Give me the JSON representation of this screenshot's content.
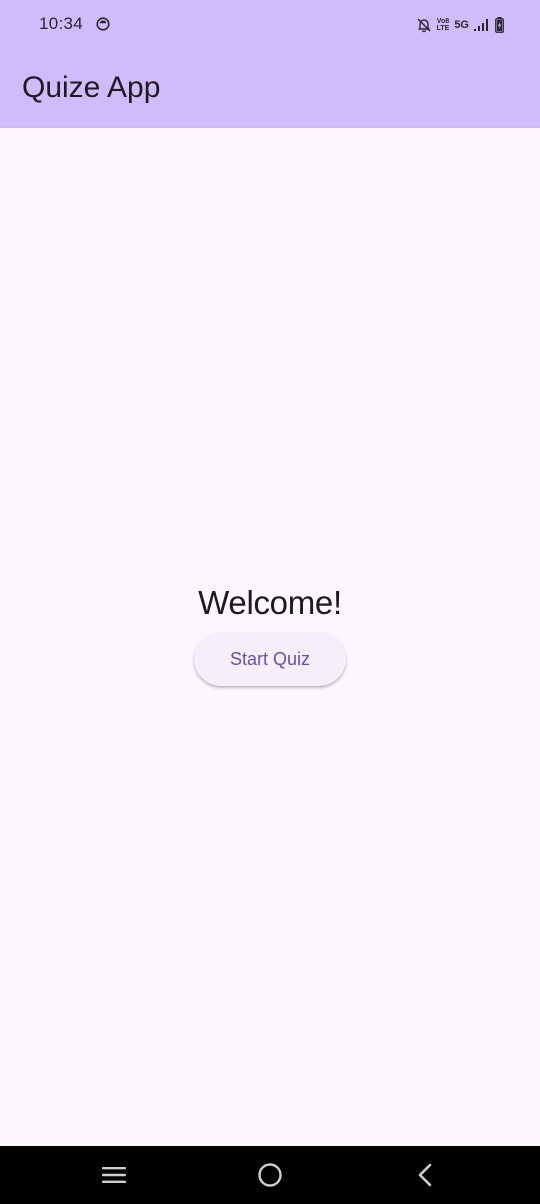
{
  "status_bar": {
    "time": "10:34",
    "app_icon": "notification-circle-icon",
    "muted_icon": "bell-off-icon",
    "volte_line1": "Vo8",
    "volte_line2": "LTE",
    "network": "5G",
    "signal_icon": "signal-icon",
    "battery_icon": "battery-charging-icon"
  },
  "app_bar": {
    "title": "Quize App",
    "background": "#d0bcfb"
  },
  "main": {
    "welcome_text": "Welcome!",
    "start_button_label": "Start Quiz",
    "accent": "#6750a4"
  },
  "nav_bar": {
    "recents_icon": "recents-icon",
    "home_icon": "home-icon",
    "back_icon": "back-icon"
  }
}
